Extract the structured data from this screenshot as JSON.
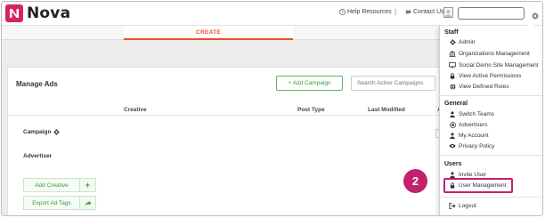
{
  "brand": {
    "name": "Nova",
    "color": "#d5255a"
  },
  "header": {
    "help_label": "Help Resources",
    "separator": "|",
    "contact_label": "Contact Us",
    "search_value": ""
  },
  "tabs": {
    "create_label": "CREATE",
    "accent": "#e8502f"
  },
  "main": {
    "title": "Manage Ads",
    "add_campaign_label": "+ Add Campaign",
    "search_placeholder": "Search Active Campaigns",
    "columns": [
      "Creative",
      "Post Type",
      "Last Modified",
      "A"
    ],
    "rows": {
      "campaign_label": "Campaign",
      "advertiser_label": "Advertiser"
    },
    "add_creative_label": "Add Creative",
    "add_creative_action": "+",
    "export_label": "Export Ad Tags",
    "export_icon": "share-arrow-icon"
  },
  "menu": {
    "staff_heading": "Staff",
    "staff_items": [
      {
        "label": "Admin",
        "icon": "gear-icon"
      },
      {
        "label": "Organizations Management",
        "icon": "bank-icon"
      },
      {
        "label": "Social Demo Site Management",
        "icon": "monitor-icon"
      },
      {
        "label": "View Active Permissions",
        "icon": "lock-icon"
      },
      {
        "label": "View Defined Roles",
        "icon": "globe-icon"
      }
    ],
    "general_heading": "General",
    "general_items": [
      {
        "label": "Switch Teams",
        "icon": "user-icon"
      },
      {
        "label": "Advertisers",
        "icon": "target-icon"
      },
      {
        "label": "My Account",
        "icon": "user-icon"
      },
      {
        "label": "Privacy Policy",
        "icon": "eye-icon"
      }
    ],
    "users_heading": "Users",
    "users_items": [
      {
        "label": "Invite User",
        "icon": "user-icon"
      },
      {
        "label": "User Management",
        "icon": "lock-icon"
      }
    ],
    "logout_label": "Logout",
    "logout_icon": "logout-icon"
  },
  "annotation": {
    "step": "2",
    "color": "#c0226c"
  }
}
